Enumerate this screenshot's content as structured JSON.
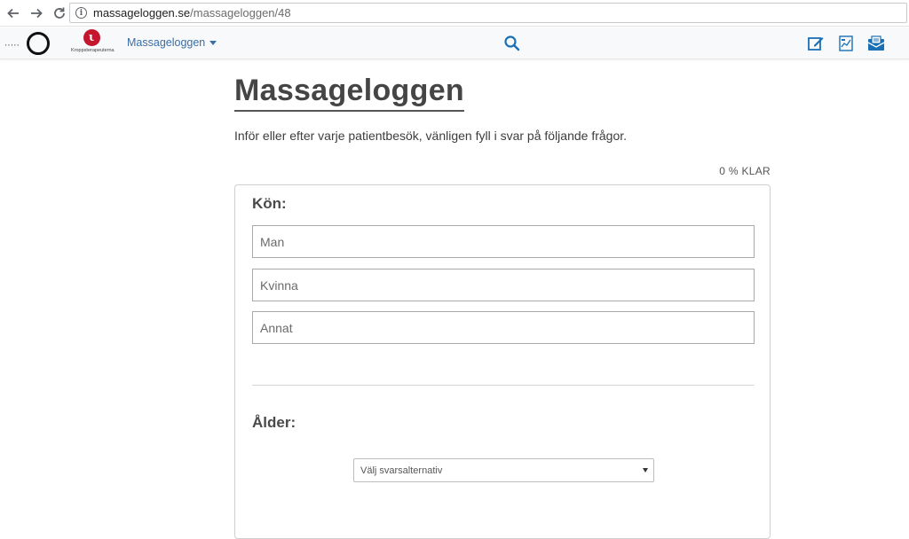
{
  "browser": {
    "url_host": "massageloggen.se",
    "url_path": "/massageloggen/48"
  },
  "header": {
    "logo_right_caption": "Kroppsterapeuterna",
    "menu_label": "Massageloggen",
    "icons": [
      "edit-icon",
      "report-icon",
      "inbox-icon"
    ],
    "accent_color": "#1a6fb5"
  },
  "main": {
    "title": "Massageloggen",
    "intro": "Inför eller efter varje patientbesök, vänligen fyll i svar på följande frågor.",
    "progress": "0 % KLAR",
    "questions": [
      {
        "label": "Kön:",
        "options": [
          "Man",
          "Kvinna",
          "Annat"
        ]
      },
      {
        "label": "Ålder:",
        "select_placeholder": "Välj svarsalternativ"
      }
    ]
  }
}
